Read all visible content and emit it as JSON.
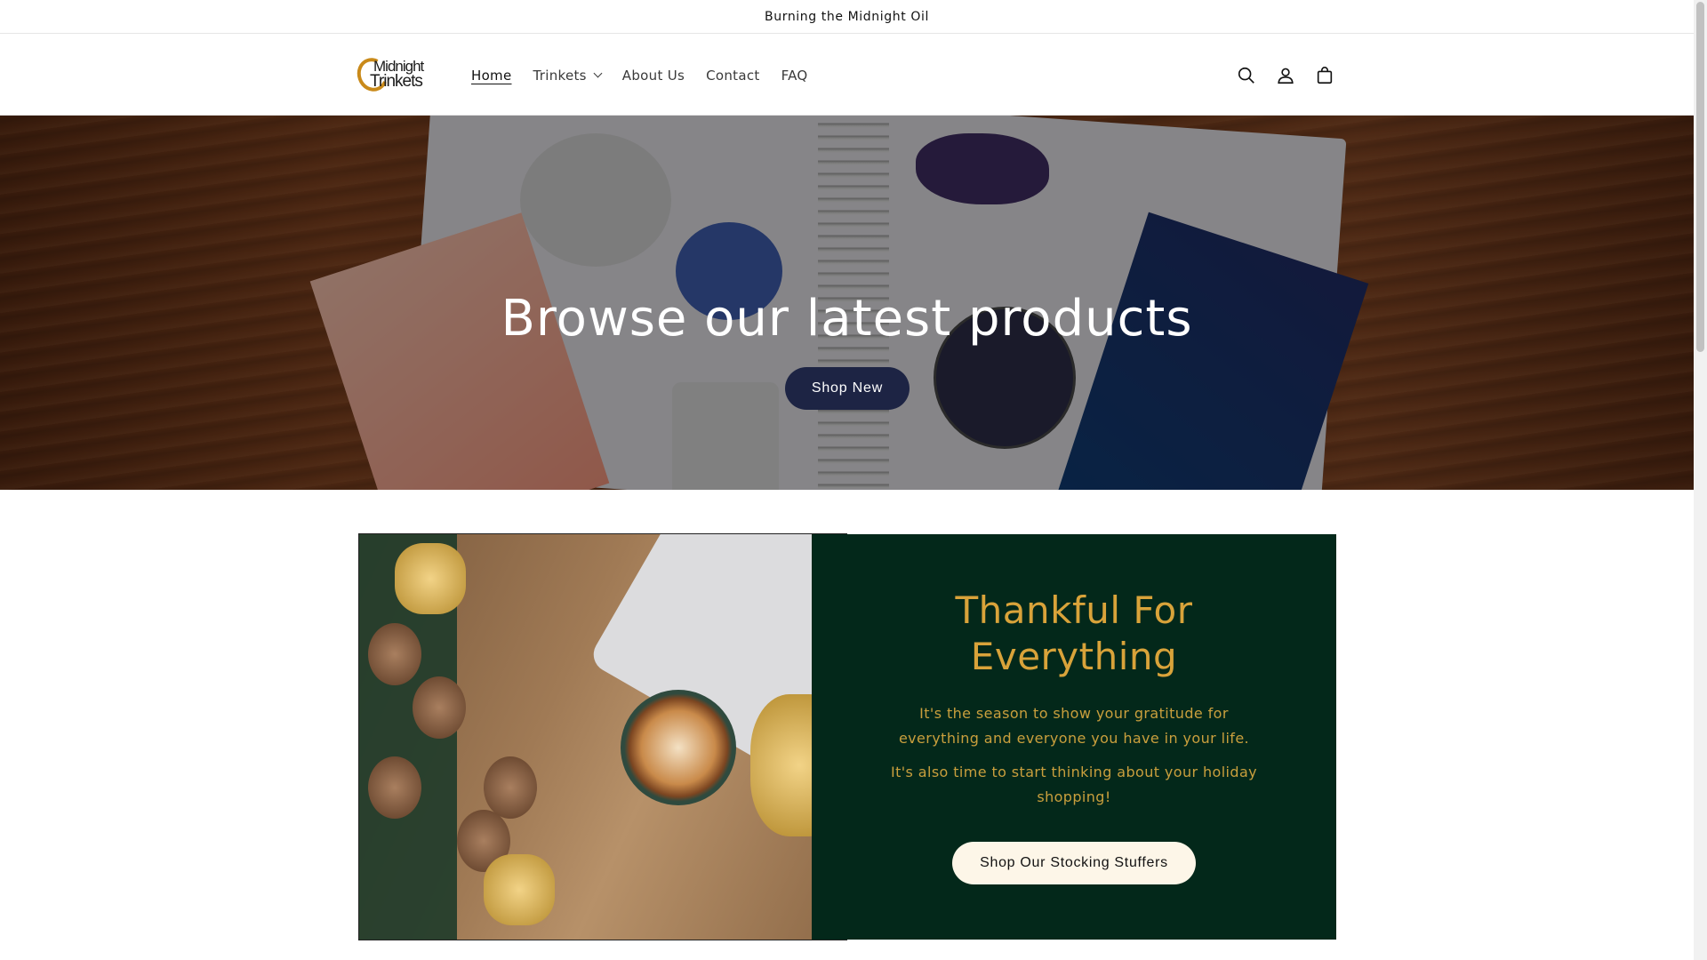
{
  "announcement": {
    "text": "Burning the Midnight Oil"
  },
  "header": {
    "logo": {
      "line1": "Midnight",
      "line2": "Trinkets"
    },
    "nav": [
      {
        "label": "Home",
        "active": true
      },
      {
        "label": "Trinkets",
        "dropdown": true
      },
      {
        "label": "About Us"
      },
      {
        "label": "Contact"
      },
      {
        "label": "FAQ"
      }
    ],
    "icons": [
      "search-icon",
      "account-icon",
      "cart-icon"
    ]
  },
  "hero": {
    "title": "Browse our latest products",
    "button_label": "Shop New"
  },
  "feature": {
    "title": "Thankful For Everything",
    "paragraph1": "It's the season to show your gratitude for everything and everyone you have in your life.",
    "paragraph2": "It's also time to start thinking about your holiday shopping!",
    "button_label": "Shop Our Stocking Stuffers"
  },
  "colors": {
    "accent_gold": "#d9a33a",
    "panel_green": "#03281a",
    "hero_button": "#1d2444",
    "logo_gold": "#c98a1a"
  }
}
